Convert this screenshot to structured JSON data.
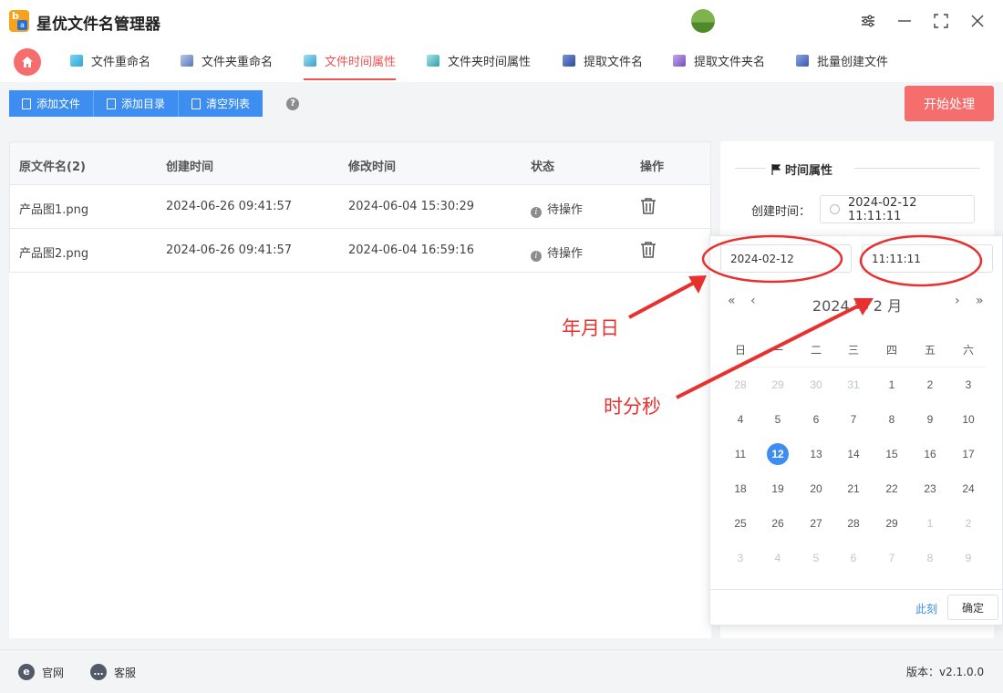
{
  "app": {
    "title": "星优文件名管理器",
    "version_label": "版本：v2.1.0.0"
  },
  "tabs": [
    {
      "label": "文件重命名",
      "icon": "rename-file-icon"
    },
    {
      "label": "文件夹重命名",
      "icon": "rename-folder-icon"
    },
    {
      "label": "文件时间属性",
      "icon": "file-time-icon",
      "active": true
    },
    {
      "label": "文件夹时间属性",
      "icon": "folder-time-icon"
    },
    {
      "label": "提取文件名",
      "icon": "extract-filename-icon"
    },
    {
      "label": "提取文件夹名",
      "icon": "extract-foldername-icon"
    },
    {
      "label": "批量创建文件",
      "icon": "batch-create-icon"
    }
  ],
  "toolbar": {
    "add_file": "添加文件",
    "add_dir": "添加目录",
    "clear_list": "清空列表",
    "help": "?",
    "start": "开始处理"
  },
  "table": {
    "headers": {
      "name": "原文件名(2)",
      "created": "创建时间",
      "modified": "修改时间",
      "status": "状态",
      "action": "操作"
    },
    "rows": [
      {
        "name": "产品图1.png",
        "created": "2024-06-26 09:41:57",
        "modified": "2024-06-04 15:30:29",
        "status": "待操作"
      },
      {
        "name": "产品图2.png",
        "created": "2024-06-26 09:41:57",
        "modified": "2024-06-04 16:59:16",
        "status": "待操作"
      }
    ]
  },
  "panel": {
    "title": "时间属性",
    "created_label": "创建时间：",
    "created_value": "2024-02-12 11:11:11"
  },
  "picker": {
    "date_value": "2024-02-12",
    "time_value": "11:11:11",
    "month_title": "2024 年 2 月",
    "weekdays": [
      "日",
      "一",
      "二",
      "三",
      "四",
      "五",
      "六"
    ],
    "weeks": [
      [
        "28",
        "29",
        "30",
        "31",
        "1",
        "2",
        "3"
      ],
      [
        "4",
        "5",
        "6",
        "7",
        "8",
        "9",
        "10"
      ],
      [
        "11",
        "12",
        "13",
        "14",
        "15",
        "16",
        "17"
      ],
      [
        "18",
        "19",
        "20",
        "21",
        "22",
        "23",
        "24"
      ],
      [
        "25",
        "26",
        "27",
        "28",
        "29",
        "1",
        "2"
      ],
      [
        "3",
        "4",
        "5",
        "6",
        "7",
        "8",
        "9"
      ]
    ],
    "selected_day": "12",
    "now_label": "此刻",
    "ok_label": "确定"
  },
  "annotations": {
    "date_note": "年月日",
    "time_note": "时分秒",
    "color": "#e8312f"
  },
  "footer": {
    "website": "官网",
    "support": "客服"
  },
  "colors": {
    "accent_red": "#f56d6d",
    "accent_blue": "#3d8ef0"
  }
}
